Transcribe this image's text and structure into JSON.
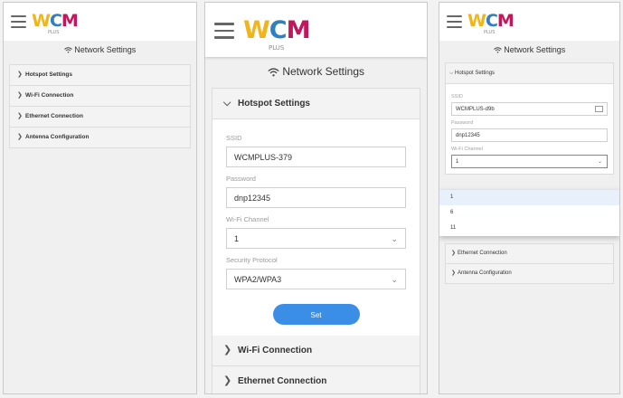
{
  "logo": {
    "w": "W",
    "c": "C",
    "m": "M",
    "plus": "PLUS"
  },
  "page_title": "Network Settings",
  "sections": {
    "hotspot": "Hotspot Settings",
    "wifi": "Wi-Fi Connection",
    "ethernet": "Ethernet Connection",
    "antenna": "Antenna Configuration"
  },
  "hotspot_form": {
    "ssid_label": "SSID",
    "ssid_value": "WCMPLUS-379",
    "password_label": "Password",
    "password_value": "dnp12345",
    "channel_label": "Wi-Fi Channel",
    "channel_value": "1",
    "protocol_label": "Security Protocol",
    "protocol_value": "WPA2/WPA3",
    "set_label": "Set"
  },
  "panel3": {
    "ssid_value": "WCMPLUS-d9b",
    "password_value": "dnp12345",
    "channel_value": "1",
    "channel_options": [
      "1",
      "6",
      "11"
    ]
  },
  "icons": {
    "menu": "hamburger-icon",
    "wifi": "wifi-icon",
    "chevron_right": "chevron-right-icon",
    "chevron_down": "chevron-down-icon",
    "keyboard": "keyboard-icon"
  }
}
